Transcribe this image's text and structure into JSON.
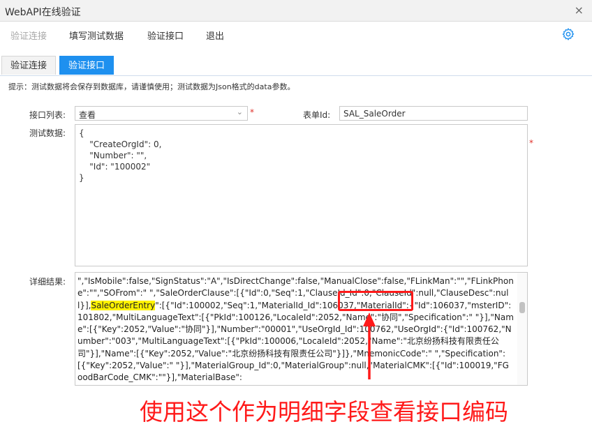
{
  "window": {
    "title": "WebAPI在线验证",
    "close": "×"
  },
  "menu": {
    "items": [
      "验证连接",
      "填写测试数据",
      "验证接口",
      "退出"
    ]
  },
  "tabs": [
    "验证连接",
    "验证接口"
  ],
  "hint": "提示：测试数据将会保存到数据库，请谨慎使用；测试数据为Json格式的data参数。",
  "form": {
    "api_list_label": "接口列表:",
    "api_list_value": "查看",
    "form_id_label": "表单Id:",
    "form_id_value": "SAL_SaleOrder",
    "test_data_label": "测试数据:",
    "test_data_value": "{\n    \"CreateOrgId\": 0,\n    \"Number\": \"\",\n    \"Id\": \"100002\"\n}",
    "required_mark": "*",
    "result_label": "详细结果:"
  },
  "result": {
    "text_before": "\",\"IsMobile\":false,\"SignStatus\":\"A\",\"IsDirectChange\":false,\"ManualClose\":false,\"FLinkMan\":\"\",\"FLinkPhone\":\"\",\"SOFrom\":\" \",\"SaleOrderClause\":[{\"Id\":0,\"Seq\":1,\"ClauseId_Id\":0,\"ClauseId\":null,\"ClauseDesc\":null}],",
    "highlight": "SaleOrderEntry",
    "text_after": "\":[{\"Id\":100002,\"Seq\":1,\"MaterialId_Id\":106037,\"MaterialId\":{\"Id\":106037,\"msterID\":101802,\"MultiLanguageText\":[{\"PkId\":100126,\"LocaleId\":2052,\"Name\":\"协同\",\"Specification\":\" \"}],\"Name\":[{\"Key\":2052,\"Value\":\"协同\"}],\"Number\":\"00001\",\"UseOrgId_Id\":100762,\"UseOrgId\":{\"Id\":100762,\"Number\":\"003\",\"MultiLanguageText\":[{\"PkId\":100006,\"LocaleId\":2052,\"Name\":\"北京纷扬科技有限责任公司\"}],\"Name\":[{\"Key\":2052,\"Value\":\"北京纷扬科技有限责任公司\"}]},\"MnemonicCode\":\" \",\"Specification\":[{\"Key\":2052,\"Value\":\" \"}],\"MaterialGroup_Id\":0,\"MaterialGroup\":null,\"MaterialCMK\":[{\"Id\":100019,\"FGoodBarCode_CMK\":\"\"}],\"MaterialBase\":"
  },
  "annotation": "使用这个作为明细字段查看接口编码",
  "colors": {
    "accent": "#1e90ef",
    "annotation": "#ff1a1a",
    "highlight": "#fff200"
  }
}
